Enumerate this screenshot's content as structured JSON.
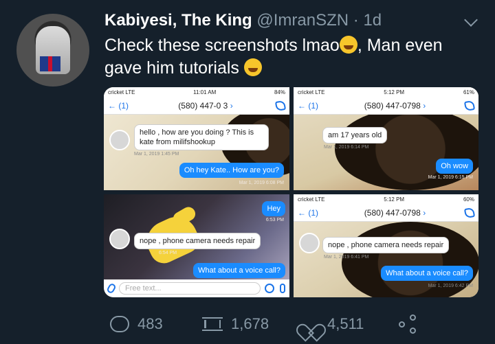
{
  "tweet": {
    "display_name": "Kabiyesi, The King",
    "handle": "@ImranSZN",
    "time": "· 1d",
    "text_line1": "Check these screenshots lmao",
    "text_line2_after": ", Man even",
    "text_line3": "gave him tutorials"
  },
  "screenshots": {
    "top_left": {
      "carrier": "cricket  LTE",
      "time": "11:01 AM",
      "battery": "84%",
      "back": "(1)",
      "number": "(580) 447-0  3",
      "incoming": "hello , how are you doing ? This is kate from milifshookup",
      "incoming_meta": "Mar 1, 2019 1:45 PM",
      "outgoing": "Oh hey Kate.. How are you?",
      "outgoing_meta": "Mar 1, 2019 6:08 PM"
    },
    "top_right": {
      "carrier": "cricket  LTE",
      "time": "5:12 PM",
      "battery": "61%",
      "back": "(1)",
      "number": "(580) 447-0798",
      "incoming": "am 17 years old",
      "incoming_meta": "Mar 1, 2019 6:14 PM",
      "outgoing": "Oh wow",
      "outgoing_meta": "Mar 1, 2019 6:15 PM"
    },
    "bottom_left": {
      "outgoing_top": "Hey",
      "outgoing_top_meta": "6:53 PM",
      "incoming": "nope , phone camera needs repair",
      "incoming_meta": "6:54 PM",
      "outgoing": "What about a voice call?",
      "input_placeholder": "Free text..."
    },
    "bottom_right": {
      "carrier": "cricket  LTE",
      "time": "5:12 PM",
      "battery": "60%",
      "back": "(1)",
      "number": "(580) 447-0798",
      "incoming": "nope , phone camera needs repair",
      "incoming_meta": "Mar 1, 2019 6:41 PM",
      "outgoing": "What about a voice call?",
      "outgoing_meta": "Mar 1, 2019 6:42 PM"
    }
  },
  "actions": {
    "replies": "483",
    "retweets": "1,678",
    "likes": "4,511"
  }
}
